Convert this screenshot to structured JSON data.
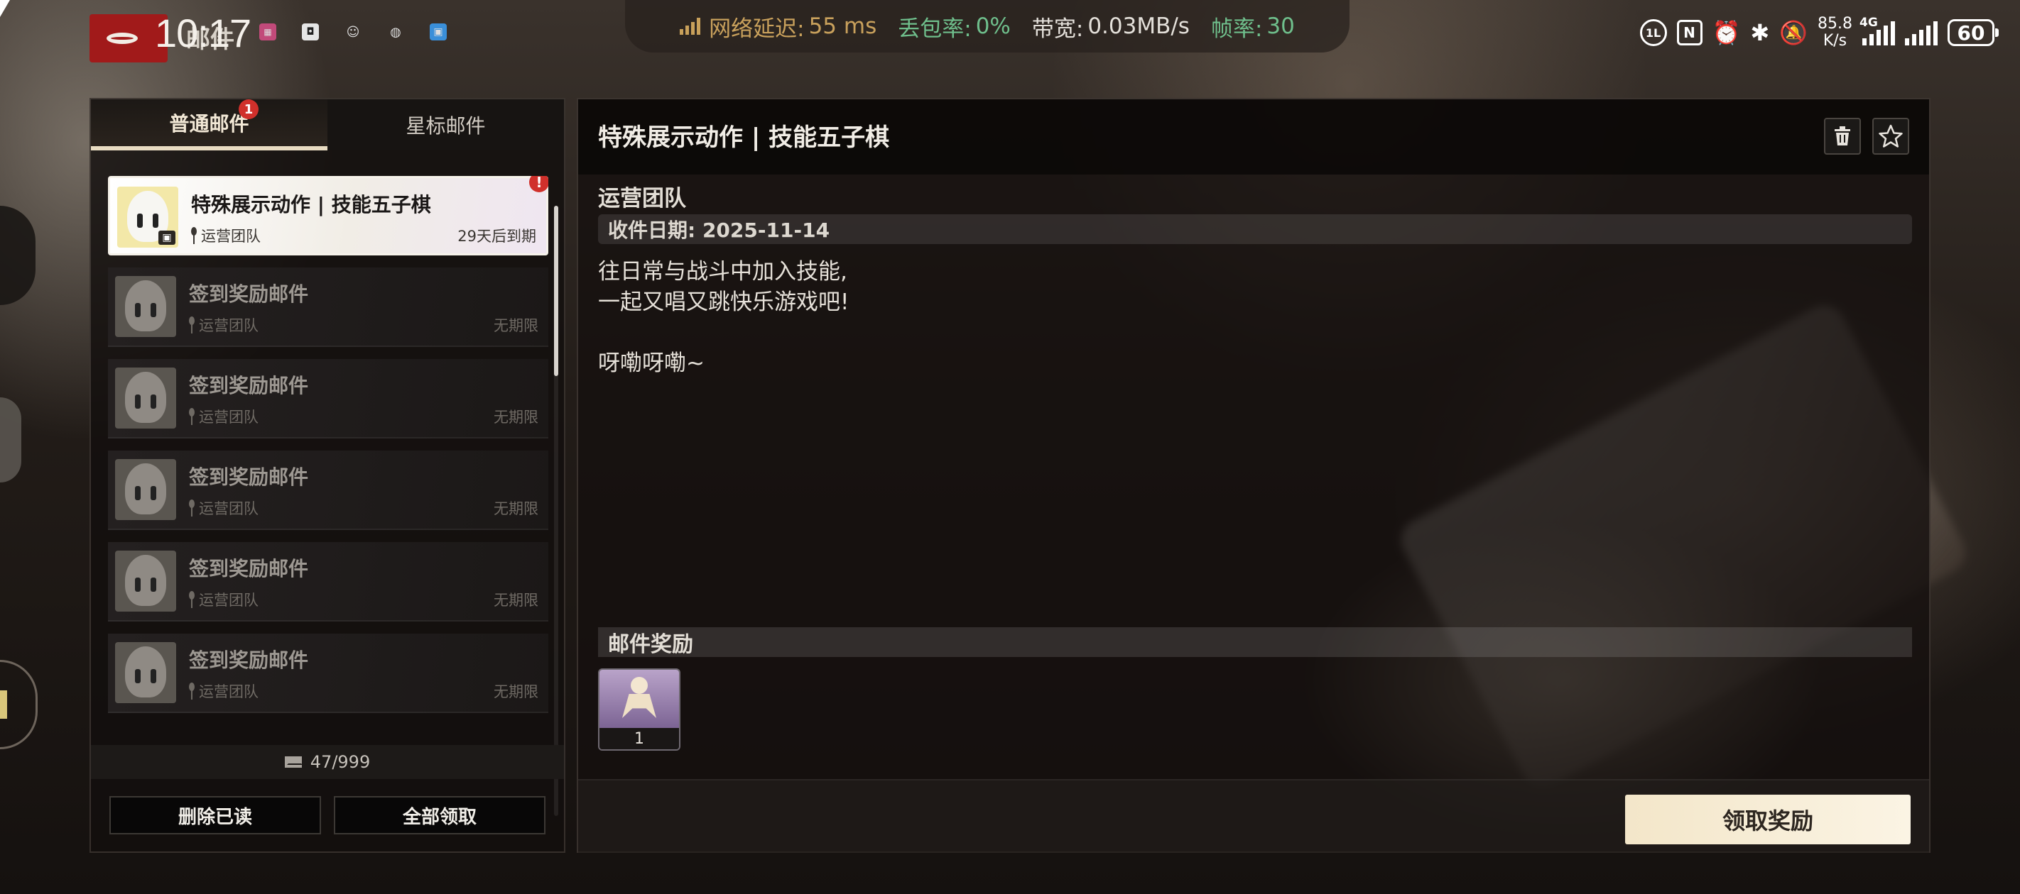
{
  "status_bar": {
    "clock": "10:17",
    "app_title": "邮件",
    "network": {
      "latency_label": "网络延迟:",
      "latency_value": "55 ms",
      "loss_label": "丢包率:",
      "loss_value": "0%",
      "bandwidth_label": "带宽:",
      "bandwidth_value": "0.03MB/s",
      "fps_label": "帧率:",
      "fps_value": "30"
    },
    "net_speed_value": "85.8",
    "net_speed_unit": "K/s",
    "signal_type": "4G",
    "battery": "60",
    "icons": [
      "game-logo-icon",
      "app-icon-1",
      "app-icon-2",
      "app-icon-3",
      "app-icon-4",
      "app-icon-5",
      "data-saver-icon",
      "nfc-icon",
      "alarm-icon",
      "bluetooth-icon",
      "mute-icon",
      "signal-icon",
      "battery-icon"
    ]
  },
  "left_panel": {
    "tabs": [
      {
        "label": "普通邮件",
        "badge": "1",
        "active": true
      },
      {
        "label": "星标邮件",
        "active": false
      }
    ],
    "mails": [
      {
        "subject": "特殊展示动作 | 技能五子棋",
        "sender": "运营团队",
        "expiry": "29天后到期",
        "selected": true,
        "unread_mark": "!"
      },
      {
        "subject": "签到奖励邮件",
        "sender": "运营团队",
        "expiry": "无期限",
        "selected": false
      },
      {
        "subject": "签到奖励邮件",
        "sender": "运营团队",
        "expiry": "无期限",
        "selected": false
      },
      {
        "subject": "签到奖励邮件",
        "sender": "运营团队",
        "expiry": "无期限",
        "selected": false
      },
      {
        "subject": "签到奖励邮件",
        "sender": "运营团队",
        "expiry": "无期限",
        "selected": false
      },
      {
        "subject": "签到奖励邮件",
        "sender": "运营团队",
        "expiry": "无期限",
        "selected": false
      }
    ],
    "count": "47/999",
    "buttons": {
      "delete_read": "删除已读",
      "claim_all": "全部领取"
    }
  },
  "detail": {
    "title": "特殊展示动作 | 技能五子棋",
    "sender": "运营团队",
    "date": "收件日期: 2025-11-14",
    "body": "往日常与战斗中加入技能,\n一起又唱又跳快乐游戏吧!\n\n呀嘞呀嘞~",
    "rewards_header": "邮件奖励",
    "rewards": [
      {
        "quantity": "1",
        "icon": "costume-reward-icon"
      }
    ],
    "claim_button": "领取奖励",
    "icons": {
      "delete": "trash-icon",
      "star": "star-icon"
    }
  },
  "colors": {
    "accent_gold": "#c9a15c",
    "accent_green": "#6fbf8c",
    "badge_red": "#d0302b",
    "claim_button": "#f3e6c9"
  }
}
